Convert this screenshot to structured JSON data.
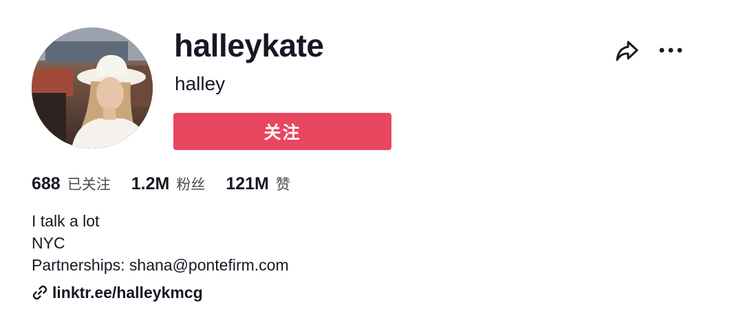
{
  "profile": {
    "username": "halleykate",
    "nickname": "halley",
    "avatar_icon": "profile-photo",
    "follow_label": "关注",
    "follow_color": "#e9465f"
  },
  "header_actions": {
    "share_icon": "share-arrow-icon",
    "more_icon": "more-dots-icon"
  },
  "stats": [
    {
      "value": "688",
      "label": "已关注"
    },
    {
      "value": "1.2M",
      "label": "粉丝"
    },
    {
      "value": "121M",
      "label": "赞"
    }
  ],
  "bio": {
    "lines": [
      "I talk a lot",
      "NYC",
      "Partnerships: shana@pontefirm.com"
    ]
  },
  "link": {
    "icon": "link-icon",
    "text": "linktr.ee/halleykmcg"
  }
}
